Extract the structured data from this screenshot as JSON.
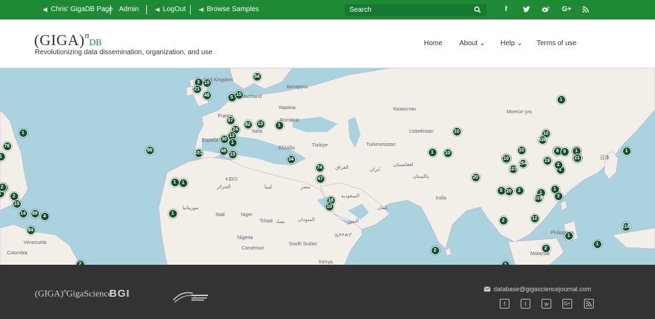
{
  "topbar": {
    "links": [
      {
        "label": "Chris' GigaDB Page",
        "icon": "user-icon"
      },
      {
        "label": "Admin"
      },
      {
        "label": "LogOut",
        "icon": "logout-icon"
      },
      {
        "label": "Browse Samples",
        "icon": "samples-icon"
      }
    ],
    "search_placeholder": "Search",
    "social": [
      "facebook-icon",
      "twitter-icon",
      "weibo-icon",
      "google-plus-icon",
      "rss-icon"
    ],
    "bg_color": "#1e8a36"
  },
  "logo": {
    "main": "(GIGA)",
    "sup": "n",
    "sub": "DB"
  },
  "tagline": "Revolutionizing data dissemination, organization, and use",
  "nav": [
    {
      "label": "Home"
    },
    {
      "label": "About",
      "dropdown": true
    },
    {
      "label": "Help",
      "dropdown": true
    },
    {
      "label": "Terms of use"
    }
  ],
  "map": {
    "labels": [
      "United Kingdom",
      "Deutschland",
      "Беларусь",
      "Україна",
      "Казахстан",
      "France",
      "Italia",
      "România",
      "España",
      "Ελλάδα",
      "Türkiye",
      "Turkmenistan",
      "Uzbekistan",
      "Монгол улс",
      "日本",
      "ⵜⵓⵏⵙ",
      "الجزائر",
      "ليبيا",
      "مصر",
      "العراق",
      "ايران",
      "افغانستان",
      "پاکستان",
      "India",
      "السعودية",
      "اليمن",
      "عمان",
      "موريتانيا",
      "Mali",
      "Niger",
      "Tchad",
      "تشاد",
      "السودان",
      "Nigeria",
      "Cameroun",
      "South Sudan",
      "ኢትዮጵያ",
      "Kenya",
      "Venezuela",
      "Colombia",
      "Philippines",
      "Malaysia"
    ],
    "markers": [
      "3",
      "10",
      "21",
      "54",
      "48",
      "5",
      "15",
      "87",
      "82",
      "13",
      "1",
      "24",
      "13",
      "30",
      "1",
      "101",
      "48",
      "15",
      "96",
      "34",
      "74",
      "47",
      "18",
      "10",
      "1",
      "1",
      "1",
      "1",
      "10",
      "10",
      "10",
      "1",
      "20",
      "5",
      "20",
      "2",
      "1",
      "519",
      "1",
      "2",
      "3",
      "12",
      "2",
      "1",
      "1",
      "2",
      "2",
      "1",
      "1",
      "2",
      "1",
      "10",
      "438",
      "10",
      "8",
      "9",
      "30",
      "38",
      "10",
      "254",
      "123",
      "19",
      "1",
      "2",
      "1",
      "1",
      "1",
      "10",
      "2",
      "15",
      "14",
      "89",
      "4",
      "84",
      "21",
      "76",
      "2",
      "216"
    ]
  },
  "footer": {
    "email": "database@gigasciencejournal.com",
    "logos": [
      "GigaScience",
      "BGI",
      "China National GeneBank"
    ],
    "social": [
      "facebook-icon",
      "twitter-icon",
      "weibo-icon",
      "google-plus-icon",
      "rss-icon"
    ]
  }
}
